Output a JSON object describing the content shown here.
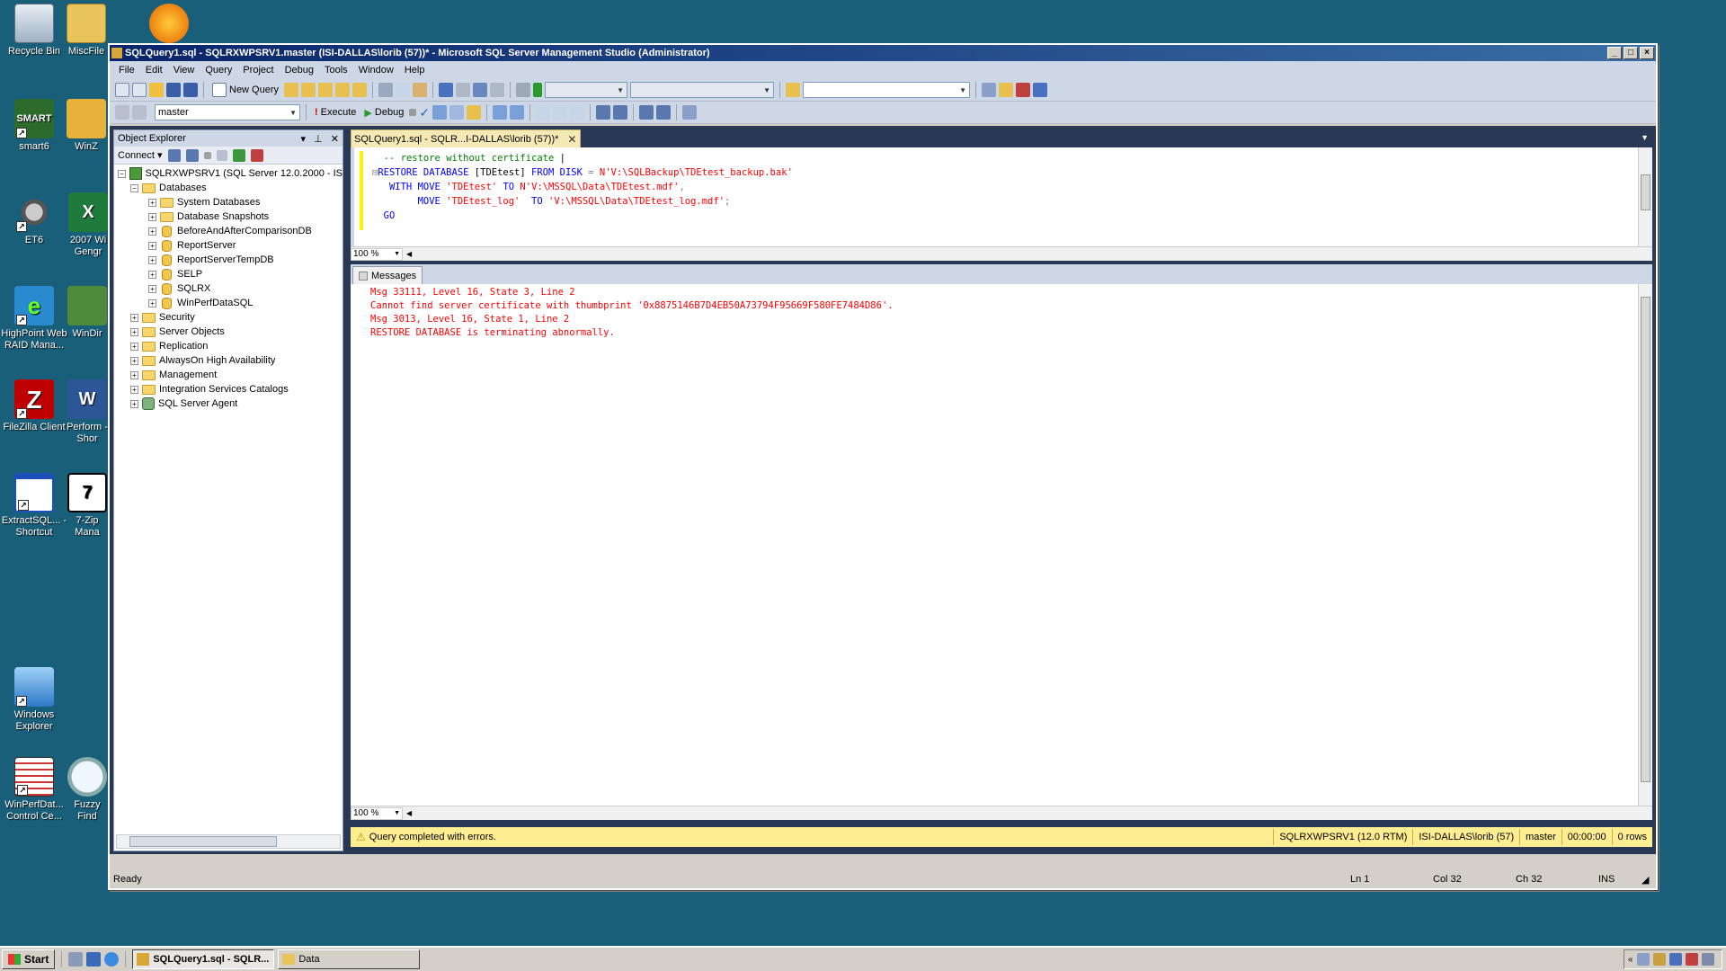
{
  "desktop": {
    "icons": [
      {
        "label": "Recycle Bin",
        "icon": "recycle-bin-icon"
      },
      {
        "label": "MiscFile",
        "icon": "folder-icon"
      },
      {
        "label": "smart6",
        "icon": "smart-icon"
      },
      {
        "label": "WinZ",
        "icon": "zip-icon"
      },
      {
        "label": "ET6",
        "icon": "steering-wheel-icon"
      },
      {
        "label": "2007 Wi Gengr",
        "icon": "excel-icon"
      },
      {
        "label": "HighPoint Web RAID Mana...",
        "icon": "raid-icon"
      },
      {
        "label": "WinDir",
        "icon": "tree-icon"
      },
      {
        "label": "FileZilla Client",
        "icon": "filezilla-icon"
      },
      {
        "label": "Perform - Shor",
        "icon": "word-icon"
      },
      {
        "label": "ExtractSQL... - Shortcut",
        "icon": "window-icon"
      },
      {
        "label": "7-Zip Mana",
        "icon": "7zip-icon"
      },
      {
        "label": "Windows Explorer",
        "icon": "explorer-icon"
      },
      {
        "label": "WinPerfDat... Control Ce...",
        "icon": "table-icon"
      },
      {
        "label": "Fuzzy Find",
        "icon": "magnifier-icon"
      }
    ]
  },
  "window": {
    "title": "SQLQuery1.sql - SQLRXWPSRV1.master (ISI-DALLAS\\lorib (57))* - Microsoft SQL Server Management Studio (Administrator)",
    "menu": [
      "File",
      "Edit",
      "View",
      "Query",
      "Project",
      "Debug",
      "Tools",
      "Window",
      "Help"
    ],
    "toolbar": {
      "new_query": "New Query",
      "database": "master",
      "execute": "Execute",
      "debug": "Debug"
    }
  },
  "object_explorer": {
    "title": "Object Explorer",
    "connect": "Connect",
    "server": "SQLRXWPSRV1 (SQL Server 12.0.2000 - IS",
    "databases_label": "Databases",
    "databases": [
      "System Databases",
      "Database Snapshots",
      "BeforeAndAfterComparisonDB",
      "ReportServer",
      "ReportServerTempDB",
      "SELP",
      "SQLRX",
      "WinPerfDataSQL"
    ],
    "folders": [
      "Security",
      "Server Objects",
      "Replication",
      "AlwaysOn High Availability",
      "Management",
      "Integration Services Catalogs"
    ],
    "agent": "SQL Server Agent"
  },
  "editor": {
    "tab_label": "SQLQuery1.sql - SQLR...I-DALLAS\\lorib (57))*",
    "zoom": "100 %",
    "code": {
      "comment": "-- restore without certificate",
      "line2_kw1": "RESTORE DATABASE",
      "line2_obj": " [TDEtest] ",
      "line2_kw2": "FROM DISK",
      "line2_op": " = ",
      "line2_str": "N'V:\\SQLBackup\\TDEtest_backup.bak'",
      "line3_kw": "WITH MOVE",
      "line3_str1": "'TDEtest'",
      "line3_kw2": "TO",
      "line3_str2": "N'V:\\MSSQL\\Data\\TDEtest.mdf'",
      "line4_kw": "MOVE",
      "line4_str1": "'TDEtest_log'",
      "line4_kw2": "TO",
      "line4_str2": "'V:\\MSSQL\\Data\\TDEtest_log.mdf'",
      "line5": "GO"
    }
  },
  "results": {
    "tab": "Messages",
    "zoom": "100 %",
    "lines": [
      "Msg 33111, Level 16, State 3, Line 2",
      "Cannot find server certificate with thumbprint '0x8875146B7D4EB50A73794F95669F580FE7484D86'.",
      "Msg 3013, Level 16, State 1, Line 2",
      "RESTORE DATABASE is terminating abnormally."
    ]
  },
  "query_status": {
    "message": "Query completed with errors.",
    "server": "SQLRXWPSRV1 (12.0 RTM)",
    "user": "ISI-DALLAS\\lorib (57)",
    "database": "master",
    "time": "00:00:00",
    "rows": "0 rows"
  },
  "app_status": {
    "ready": "Ready",
    "ln": "Ln 1",
    "col": "Col 32",
    "ch": "Ch 32",
    "ins": "INS"
  },
  "taskbar": {
    "start": "Start",
    "tasks": [
      "SQLQuery1.sql - SQLR...",
      "Data"
    ]
  },
  "colors": {
    "desktop": "#1a5f7a",
    "keyword": "#0000ff",
    "string": "#ff0000",
    "comment": "#008000",
    "error": "#ff0000",
    "status_bar": "#ffee91"
  }
}
